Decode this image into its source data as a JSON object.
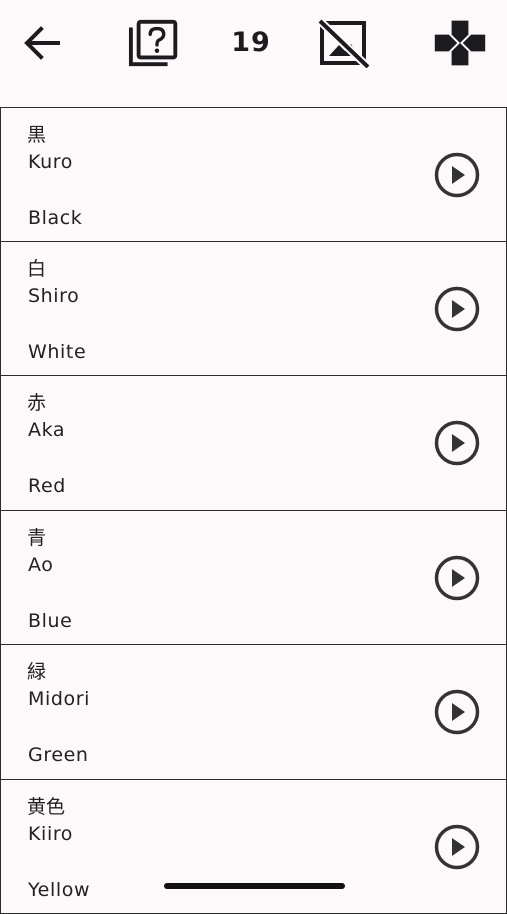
{
  "toolbar": {
    "back_icon": "arrow-left-icon",
    "quiz_icon": "question-stack-icon",
    "count": "19",
    "hide_images_icon": "image-off-icon",
    "game_icon": "gamepad-icon"
  },
  "items": [
    {
      "kanji": "黒",
      "romaji": "Kuro",
      "english": "Black"
    },
    {
      "kanji": "白",
      "romaji": "Shiro",
      "english": "White"
    },
    {
      "kanji": "赤",
      "romaji": "Aka",
      "english": "Red"
    },
    {
      "kanji": "青",
      "romaji": "Ao",
      "english": "Blue"
    },
    {
      "kanji": "緑",
      "romaji": "Midori",
      "english": "Green"
    },
    {
      "kanji": "黄色",
      "romaji": "Kiiro",
      "english": "Yellow"
    }
  ],
  "colors": {
    "background": "#fdf8f9",
    "border": "#2c2c2c",
    "icon": "#1c1b1f"
  }
}
